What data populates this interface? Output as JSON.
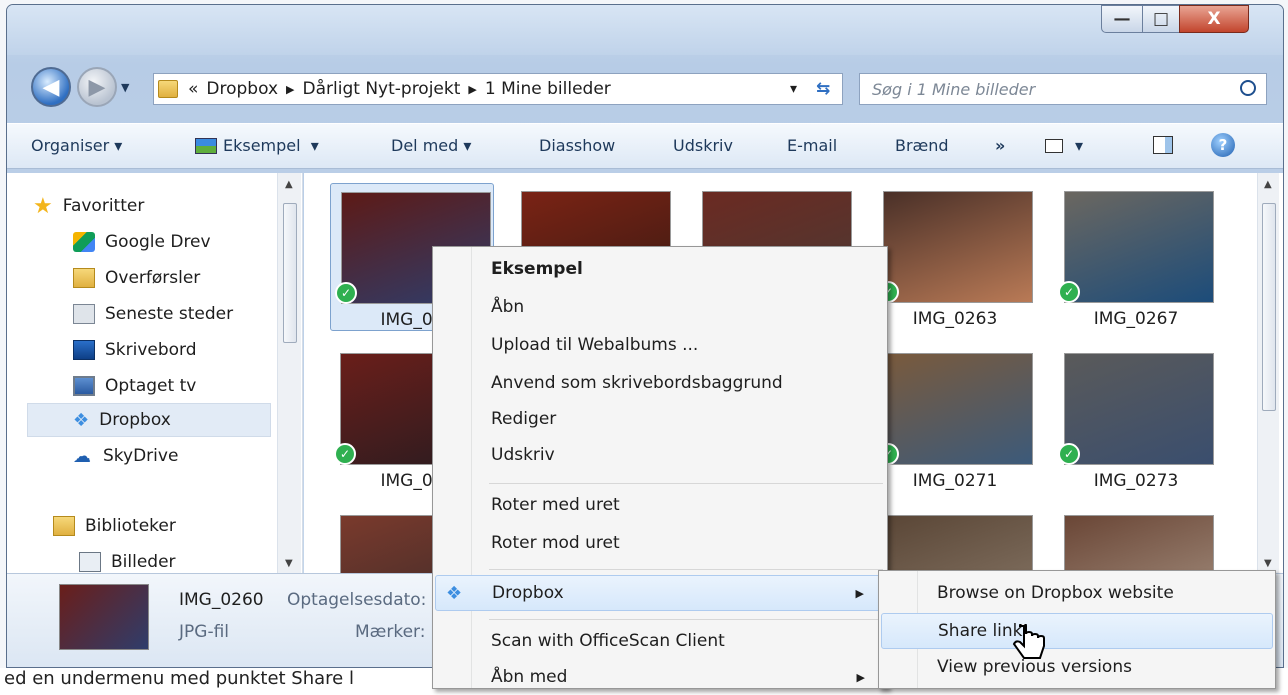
{
  "window": {
    "controls": [
      "—",
      "□",
      "X"
    ]
  },
  "address": {
    "overflow": "«",
    "crumbs": [
      "Dropbox",
      "Dårligt Nyt-projekt",
      "1 Mine billeder"
    ],
    "dropdown": "▾",
    "refresh": "⇆"
  },
  "search": {
    "placeholder": "Søg i 1 Mine billeder"
  },
  "toolbar": {
    "organise": "Organiser",
    "preview": "Eksempel",
    "share": "Del med",
    "slideshow": "Diasshow",
    "print": "Udskriv",
    "email": "E-mail",
    "burn": "Brænd",
    "more": "»"
  },
  "nav": {
    "favorites": "Favoritter",
    "items": [
      "Google Drev",
      "Overførsler",
      "Seneste steder",
      "Skrivebord",
      "Optaget tv",
      "Dropbox",
      "SkyDrive"
    ],
    "libraries": "Biblioteker",
    "lib_items": [
      "Billeder"
    ]
  },
  "files": [
    {
      "name": "IMG_02",
      "colors": [
        "#5d1a16",
        "#2f3d6b"
      ]
    },
    {
      "name": "",
      "colors": [
        "#7a2315",
        "#3b1a12"
      ]
    },
    {
      "name": "",
      "colors": [
        "#6b2a22",
        "#4b3a34"
      ]
    },
    {
      "name": "IMG_0263",
      "colors": [
        "#4a3028",
        "#b97a56"
      ]
    },
    {
      "name": "IMG_0267",
      "colors": [
        "#6b6760",
        "#1c4c7a"
      ]
    },
    {
      "name": "IMG_02",
      "colors": [
        "#6a1e1a",
        "#2b1c20"
      ]
    },
    {
      "name": "",
      "colors": [
        "#333",
        "#555"
      ]
    },
    {
      "name": "",
      "colors": [
        "#333",
        "#555"
      ]
    },
    {
      "name": "IMG_0271",
      "colors": [
        "#7a5a3c",
        "#3c5a7a"
      ]
    },
    {
      "name": "IMG_0273",
      "colors": [
        "#5a5a5a",
        "#3a4e6e"
      ]
    },
    {
      "name": "",
      "colors": [
        "#7a3a2c",
        "#3a2a2a"
      ]
    },
    {
      "name": "",
      "colors": [
        "#333",
        "#555"
      ]
    },
    {
      "name": "",
      "colors": [
        "#333",
        "#555"
      ]
    },
    {
      "name": "",
      "colors": [
        "#5a4636",
        "#8a7a6a"
      ]
    },
    {
      "name": "",
      "colors": [
        "#6a4636",
        "#a89484"
      ]
    }
  ],
  "details": {
    "name": "IMG_0260",
    "type": "JPG-fil",
    "date_label": "Optagelsesdato:",
    "tags_label": "Mærker:"
  },
  "context_menu": {
    "items": [
      "Eksempel",
      "Åbn",
      "Upload til Webalbums ...",
      "Anvend som skrivebordsbaggrund",
      "Rediger",
      "Udskriv",
      "Roter med uret",
      "Roter mod uret",
      "Dropbox",
      "Scan with OfficeScan Client",
      "Åbn med"
    ]
  },
  "submenu": {
    "items": [
      "Browse on Dropbox website",
      "Share link",
      "View previous versions"
    ]
  },
  "background_text": "ed en undermenu med punktet Share l"
}
